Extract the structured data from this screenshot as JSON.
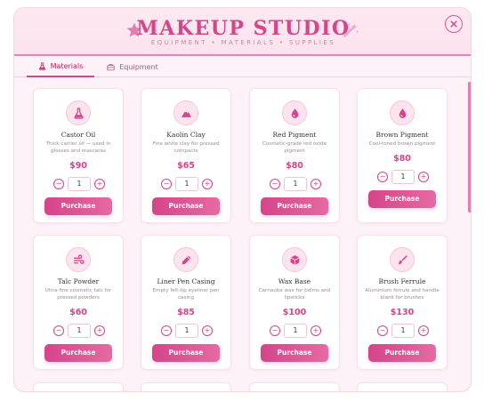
{
  "header": {
    "title": "MAKEUP STUDIO",
    "subtitle": "EQUIPMENT • MATERIALS • SUPPLIES",
    "close_label": "×",
    "title_icons": [
      "star-icon",
      "magic-wand-icon"
    ]
  },
  "tabs": [
    {
      "label": "Materials",
      "icon": "flask-icon",
      "active": true
    },
    {
      "label": "Equipment",
      "icon": "toolbox-icon",
      "active": false
    }
  ],
  "purchase_label": "Purchase",
  "colors": {
    "accent": "#d6448a",
    "accent_light": "#fde3ee",
    "background": "#fdf2f7"
  },
  "products": [
    {
      "name": "Castor Oil",
      "desc": "Thick carrier oil — used in glosses and mascaras",
      "price": "$90",
      "qty": "1",
      "icon": "flask-icon"
    },
    {
      "name": "Kaolin Clay",
      "desc": "Fine white clay for pressed compacts",
      "price": "$65",
      "qty": "1",
      "icon": "mountain-icon"
    },
    {
      "name": "Red Pigment",
      "desc": "Cosmetic-grade red oxide pigment",
      "price": "$80",
      "qty": "1",
      "icon": "droplet-icon"
    },
    {
      "name": "Brown Pigment",
      "desc": "Cool-toned brown pigment",
      "price": "$80",
      "qty": "1",
      "icon": "droplet-icon"
    },
    {
      "name": "Talc Powder",
      "desc": "Ultra-fine cosmetic talc for pressed powders",
      "price": "$60",
      "qty": "1",
      "icon": "wind-icon"
    },
    {
      "name": "Liner Pen Casing",
      "desc": "Empty felt-tip eyeliner pen casing",
      "price": "$85",
      "qty": "1",
      "icon": "pen-icon"
    },
    {
      "name": "Wax Base",
      "desc": "Carnauba wax for balms and lipsticks",
      "price": "$100",
      "qty": "1",
      "icon": "cube-icon"
    },
    {
      "name": "Brush Ferrule",
      "desc": "Aluminium ferrule and handle blank for brushes",
      "price": "$130",
      "qty": "1",
      "icon": "brush-icon"
    }
  ]
}
